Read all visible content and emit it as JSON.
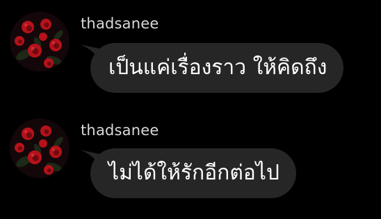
{
  "messages": [
    {
      "username": "thadsanee",
      "text": "เป็นแค่เรื่องราว ให้คิดถึง",
      "avatar_icon": "rose-avatar-icon"
    },
    {
      "username": "thadsanee",
      "text": "ไม่ได้ให้รักอีกต่อไป",
      "avatar_icon": "rose-avatar-icon"
    }
  ],
  "colors": {
    "background": "#000000",
    "bubble": "#262626",
    "username": "#d9d9d9",
    "text": "#ffffff",
    "rose": "#b5121b"
  }
}
